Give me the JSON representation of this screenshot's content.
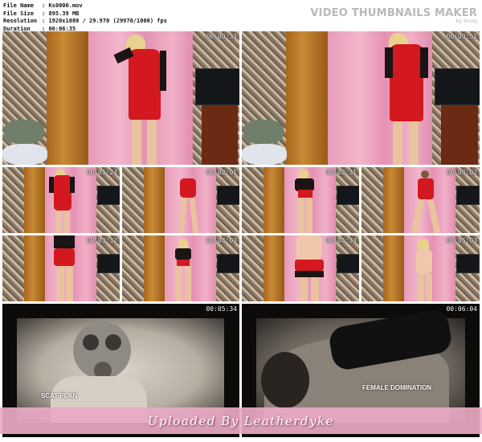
{
  "file_info": {
    "name_key": "File Name",
    "name_value": "Ks0000.mov",
    "size_key": "File Size",
    "size_value": "895.39 MB",
    "resolution_key": "Resolution",
    "resolution_value": "1920x1080 / 29.970 (29970/1000) fps",
    "duration_key": "Duration",
    "duration_value": "00:06:35"
  },
  "brand": {
    "title": "VIDEO THUMBNAILS MAKER",
    "subtitle": "by Scorp"
  },
  "thumbnails": {
    "t1": "00:00:33",
    "t2": "00:00:51",
    "t3": "00:01:24",
    "t4": "00:02:01",
    "t5": "00:02:31",
    "t6": "00:03:02",
    "t7": "00:03:32",
    "t8": "00:04:03",
    "t9": "00:04:33",
    "t10": "00:05:03",
    "t11": "00:05:34",
    "t12": "00:06:04"
  },
  "overlays": {
    "film_caption_left": "SCAT PLAN",
    "film_caption_right": "FEMALE DOMINATION"
  },
  "watermark": "Uploaded By Leatherdyke"
}
